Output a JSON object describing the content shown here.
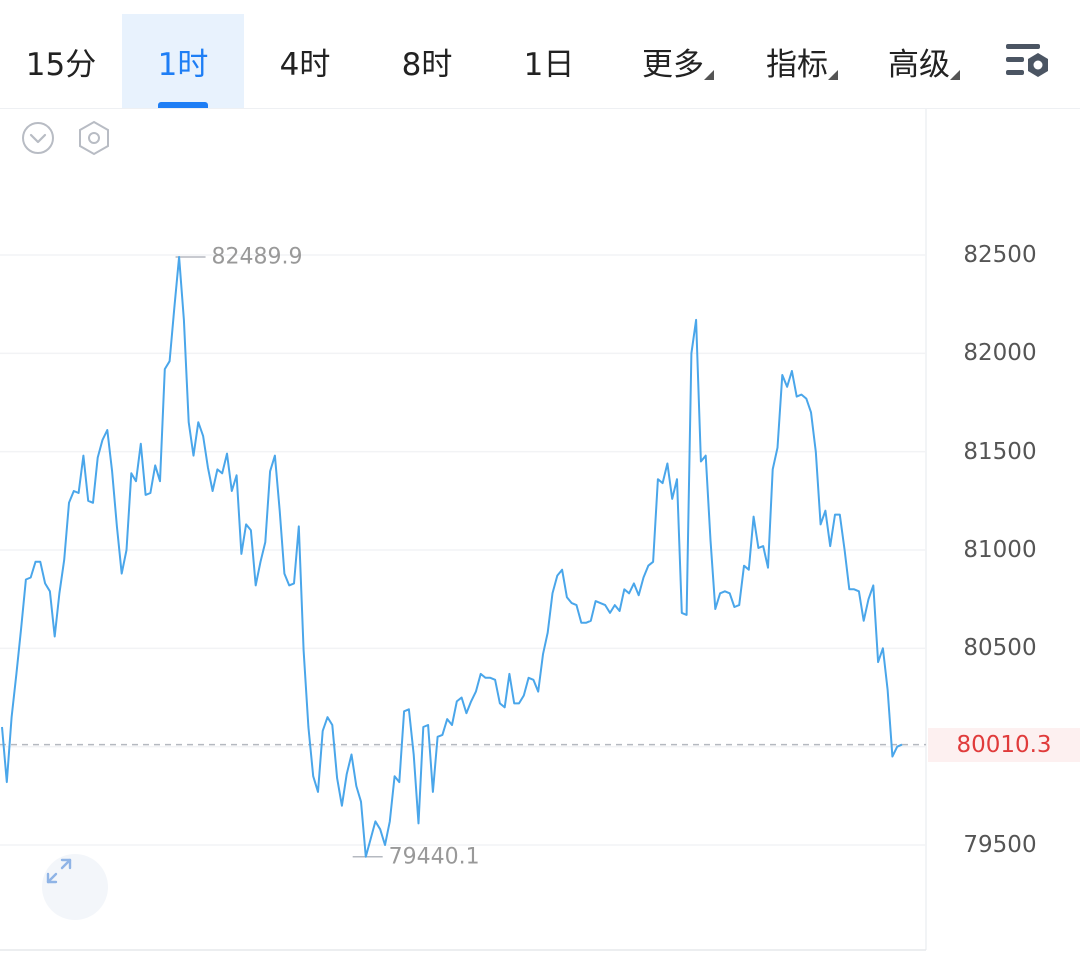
{
  "tabs": [
    {
      "label": "15分",
      "active": false,
      "dropdown": false
    },
    {
      "label": "1时",
      "active": true,
      "dropdown": false
    },
    {
      "label": "4时",
      "active": false,
      "dropdown": false
    },
    {
      "label": "8时",
      "active": false,
      "dropdown": false
    },
    {
      "label": "1日",
      "active": false,
      "dropdown": false
    },
    {
      "label": "更多",
      "active": false,
      "dropdown": true
    },
    {
      "label": "指标",
      "active": false,
      "dropdown": true
    },
    {
      "label": "高级",
      "active": false,
      "dropdown": true
    }
  ],
  "toolbar_icons": {
    "settings": "chart-settings-icon",
    "collapse": "chevron-down-circle-icon",
    "visibility": "hexagon-settings-icon",
    "expand": "expand-arrows-icon"
  },
  "colors": {
    "accent": "#1e7ef5",
    "line": "#4aa6ea",
    "price_red": "#e03b3b"
  },
  "chart_data": {
    "type": "line",
    "ylim": [
      79000,
      83000
    ],
    "yticks": [
      82500,
      82000,
      81500,
      81000,
      80500,
      79500
    ],
    "y_tick_labels": [
      "82500",
      "82000",
      "81500",
      "81000",
      "80500",
      "79500"
    ],
    "current_price": 80010.3,
    "current_price_label": "80010.3",
    "high": {
      "index": 35,
      "value": 82489.9,
      "label": "82489.9"
    },
    "low": {
      "index": 72,
      "value": 79440.1,
      "label": "79440.1"
    },
    "grid": true,
    "series": [
      {
        "values": [
          80100,
          79820,
          80150,
          80370,
          80600,
          80850,
          80860,
          80940,
          80940,
          80830,
          80790,
          80560,
          80780,
          80950,
          81240,
          81300,
          81290,
          81480,
          81250,
          81240,
          81470,
          81560,
          81610,
          81400,
          81120,
          80880,
          81000,
          81390,
          81350,
          81540,
          81280,
          81290,
          81430,
          81350,
          81920,
          81960,
          82230,
          82489.9,
          82170,
          81650,
          81480,
          81650,
          81580,
          81420,
          81300,
          81410,
          81390,
          81490,
          81300,
          81380,
          80980,
          81130,
          81100,
          80820,
          80940,
          81040,
          81400,
          81480,
          81200,
          80880,
          80820,
          80830,
          81120,
          80490,
          80100,
          79850,
          79770,
          80080,
          80150,
          80110,
          79840,
          79700,
          79860,
          79960,
          79800,
          79720,
          79440.1,
          79530,
          79620,
          79580,
          79500,
          79620,
          79850,
          79820,
          80180,
          80190,
          79960,
          79610,
          80100,
          80110,
          79770,
          80050,
          80060,
          80140,
          80110,
          80230,
          80250,
          80170,
          80230,
          80280,
          80370,
          80350,
          80350,
          80340,
          80220,
          80200,
          80370,
          80220,
          80220,
          80260,
          80350,
          80340,
          80280,
          80470,
          80580,
          80780,
          80870,
          80900,
          80760,
          80730,
          80720,
          80630,
          80630,
          80640,
          80740,
          80730,
          80720,
          80680,
          80720,
          80690,
          80800,
          80780,
          80830,
          80770,
          80860,
          80920,
          80940,
          81360,
          81340,
          81440,
          81260,
          81360,
          80680,
          80670,
          82000,
          82170,
          81450,
          81480,
          81050,
          80700,
          80780,
          80790,
          80780,
          80710,
          80720,
          80920,
          80900,
          81170,
          81010,
          81020,
          80910,
          81410,
          81520,
          81890,
          81830,
          81910,
          81780,
          81790,
          81770,
          81700,
          81500,
          81130,
          81200,
          81020,
          81180,
          81180,
          81000,
          80800,
          80800,
          80790,
          80640,
          80750,
          80820,
          80430,
          80500,
          80290,
          79950,
          80000,
          80010.3
        ]
      }
    ],
    "x_tick_labels": []
  }
}
